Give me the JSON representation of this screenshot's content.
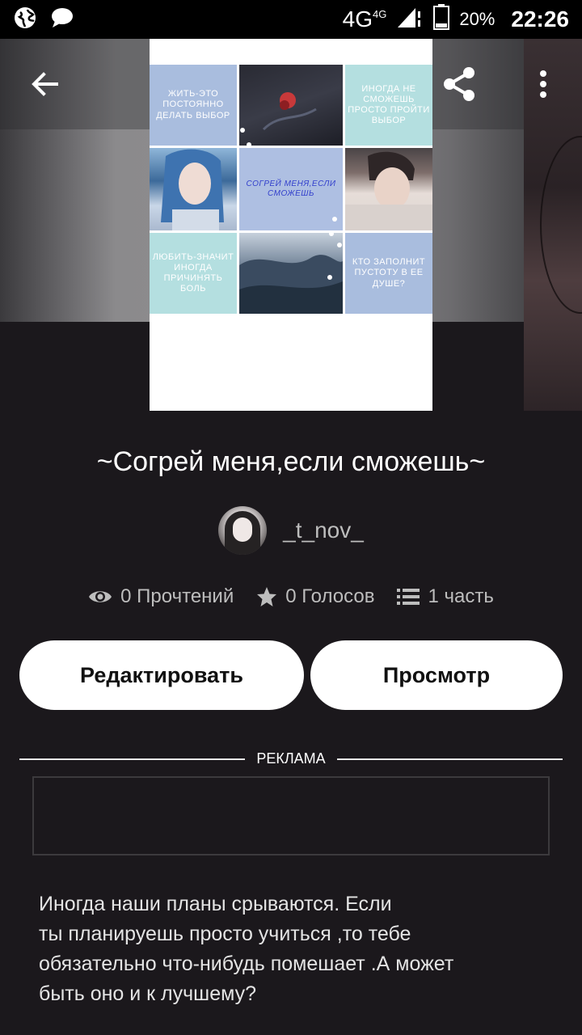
{
  "status_bar": {
    "network": "4G",
    "network_small": "4G",
    "battery": "20%",
    "time": "22:26",
    "icons": [
      "globe-icon",
      "chat-bubble-icon",
      "signal-icon",
      "battery-icon"
    ]
  },
  "cover": {
    "tiles": [
      {
        "text": "ЖИТЬ-ЭТО ПОСТОЯННО ДЕЛАТЬ ВЫБОР"
      },
      {
        "text": ""
      },
      {
        "text": "ИНОГДА НЕ СМОЖЕШЬ ПРОСТО ПРОЙТИ ВЫБОР"
      },
      {
        "text": ""
      },
      {
        "text": "СОГРЕЙ МЕНЯ,ЕСЛИ СМОЖЕШЬ"
      },
      {
        "text": ""
      },
      {
        "text": "ЛЮБИТЬ-ЗНАЧИТ ИНОГДА ПРИЧИНЯТЬ БОЛЬ"
      },
      {
        "text": ""
      },
      {
        "text": "КТО ЗАПОЛНИТ ПУСТОТУ В ЕЕ ДУШЕ?"
      }
    ]
  },
  "story": {
    "title": "~Согрей меня,если сможешь~",
    "author": "_t_nov_",
    "reads": "0 Прочтений",
    "votes": "0 Голосов",
    "parts": "1 часть"
  },
  "buttons": {
    "edit": "Редактировать",
    "preview": "Просмотр"
  },
  "ad": {
    "label": "РЕКЛАМА"
  },
  "description": "Иногда наши планы срываются. Если\nты планируешь просто учиться ,то тебе\nобязательно что-нибудь помешает .А может\nбыть оно и к лучшему?",
  "colors": {
    "background": "#1b181c",
    "button_bg": "#ffffff",
    "muted_text": "#bdbdbd"
  }
}
